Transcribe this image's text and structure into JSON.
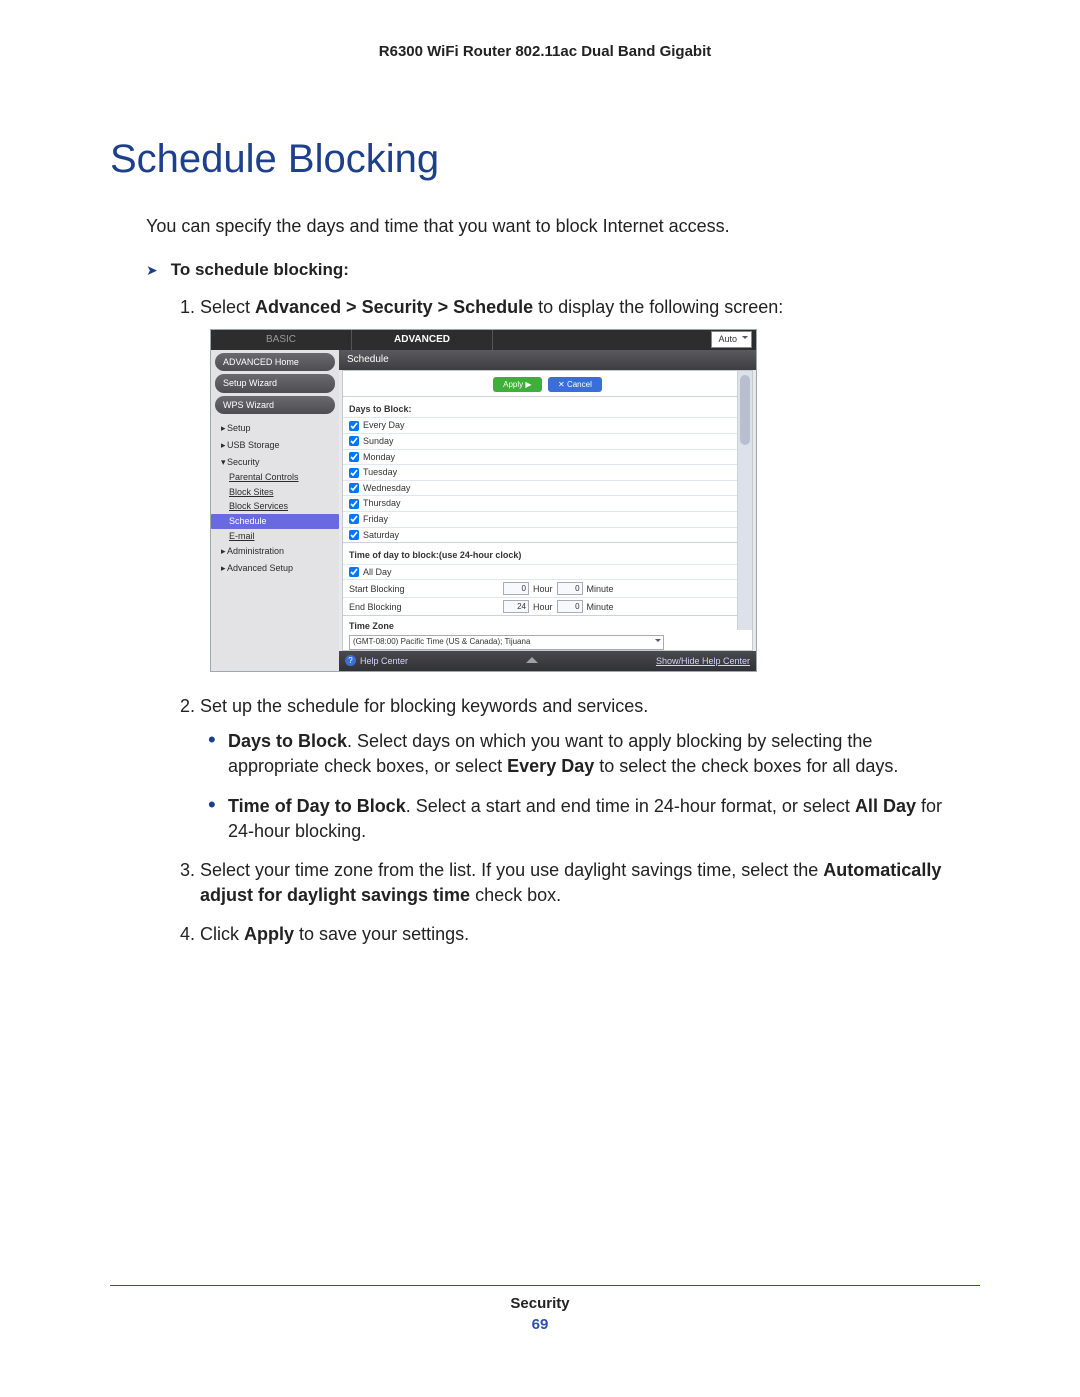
{
  "header": {
    "product": "R6300 WiFi Router 802.11ac Dual Band Gigabit"
  },
  "section": {
    "title": "Schedule Blocking"
  },
  "intro": "You can specify the days and time that you want to block Internet access.",
  "proc": {
    "label": "To schedule blocking:"
  },
  "step1": {
    "pre": "Select ",
    "path": "Advanced > Security > Schedule",
    "post": " to display the following screen:"
  },
  "ui": {
    "tabs": {
      "basic": "BASIC",
      "advanced": "ADVANCED",
      "lang": "Auto"
    },
    "sidebar": {
      "advanced_home": "ADVANCED Home",
      "setup_wizard": "Setup Wizard",
      "wps_wizard": "WPS Wizard",
      "setup": "Setup",
      "usb": "USB Storage",
      "security": "Security",
      "parental": "Parental Controls",
      "block_sites": "Block Sites",
      "block_services": "Block Services",
      "schedule": "Schedule",
      "email": "E-mail",
      "admin": "Administration",
      "adv_setup": "Advanced Setup"
    },
    "panel": {
      "title": "Schedule",
      "apply": "Apply ▶",
      "cancel": "✕ Cancel",
      "days_title": "Days to Block:",
      "days": [
        "Every Day",
        "Sunday",
        "Monday",
        "Tuesday",
        "Wednesday",
        "Thursday",
        "Friday",
        "Saturday"
      ],
      "time_title": "Time of day to block:(use 24-hour clock)",
      "all_day": "All Day",
      "start": "Start Blocking",
      "end": "End Blocking",
      "start_h": "0",
      "end_h": "24",
      "start_m": "0",
      "end_m": "0",
      "hour": "Hour",
      "minute": "Minute",
      "tz_title": "Time Zone",
      "tz_value": "(GMT-08:00) Pacific Time (US & Canada); Tijuana",
      "help": "Help Center",
      "showhide": "Show/Hide Help Center"
    }
  },
  "step2": {
    "text": "Set up the schedule for blocking keywords and services.",
    "b1": {
      "bold": "Days to Block",
      "rest": ". Select days on which you want to apply blocking by selecting the appropriate check boxes, or select ",
      "bold2": "Every Day",
      "rest2": " to select the check boxes for all days."
    },
    "b2": {
      "bold": "Time of Day to Block",
      "rest": ". Select a start and end time in 24-hour format, or select ",
      "bold2": "All Day",
      "rest2": " for 24-hour blocking."
    }
  },
  "step3": {
    "pre": "Select your time zone from the list. If you use daylight savings time, select the ",
    "bold": "Automatically adjust for daylight savings time",
    "post": " check box."
  },
  "step4": {
    "pre": "Click ",
    "bold": "Apply",
    "post": " to save your settings."
  },
  "footer": {
    "section": "Security",
    "page": "69"
  }
}
